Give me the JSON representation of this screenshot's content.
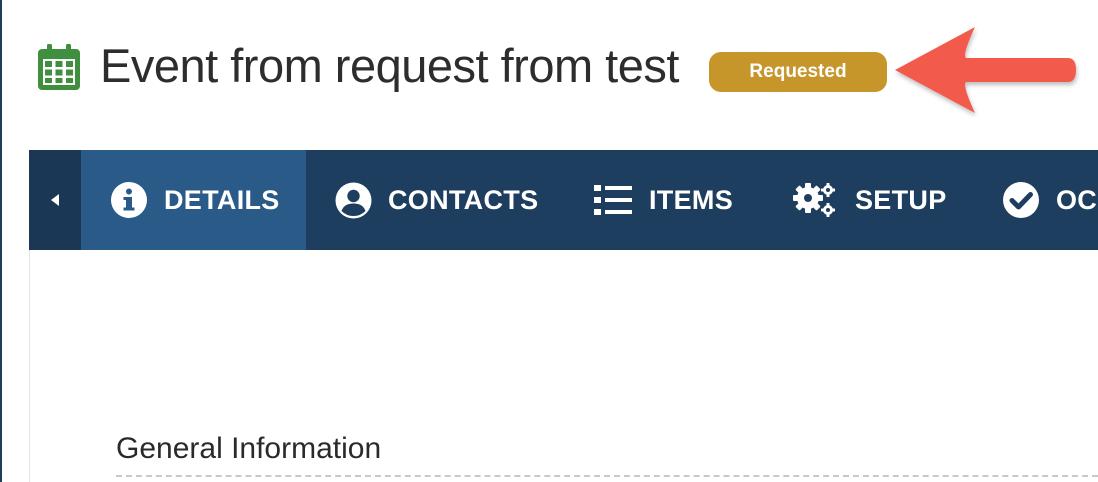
{
  "header": {
    "icon": "calendar-icon",
    "title": "Event from request from test",
    "status": "Requested",
    "status_color": "#c7962a",
    "annotation": "arrow-icon",
    "annotation_color": "#f25a4c"
  },
  "tabs": {
    "bar_color": "#1d3e5e",
    "active_color": "#2a5b88",
    "scroll_icon": "caret-left-icon",
    "items": [
      {
        "label": "DETAILS",
        "icon": "info-circle-icon",
        "active": true
      },
      {
        "label": "CONTACTS",
        "icon": "user-circle-icon",
        "active": false
      },
      {
        "label": "ITEMS",
        "icon": "list-icon",
        "active": false
      },
      {
        "label": "SETUP",
        "icon": "gears-icon",
        "active": false
      },
      {
        "label": "OCC",
        "icon": "check-circle-icon",
        "active": false
      }
    ]
  },
  "main": {
    "section_title": "General Information"
  }
}
